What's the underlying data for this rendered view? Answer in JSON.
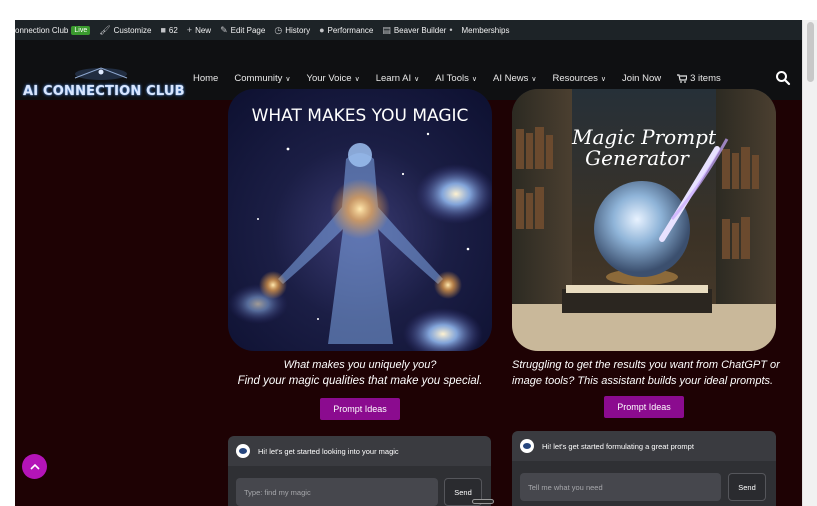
{
  "adminbar": {
    "site_name": "onnection Club",
    "live_badge": "Live",
    "customize": "Customize",
    "comments_count": "62",
    "new": "New",
    "edit_page": "Edit Page",
    "history": "History",
    "performance": "Performance",
    "beaver_builder": "Beaver Builder",
    "memberships": "Memberships"
  },
  "header": {
    "logo_text": "AI CONNECTION CLUB",
    "nav": [
      {
        "label": "Home",
        "has_caret": false
      },
      {
        "label": "Community",
        "has_caret": true
      },
      {
        "label": "Your Voice",
        "has_caret": true
      },
      {
        "label": "Learn AI",
        "has_caret": true
      },
      {
        "label": "AI Tools",
        "has_caret": true
      },
      {
        "label": "AI News",
        "has_caret": true
      },
      {
        "label": "Resources",
        "has_caret": true
      },
      {
        "label": "Join Now",
        "has_caret": false
      },
      {
        "label": "3 items",
        "has_caret": false
      }
    ],
    "search_icon": "search-icon"
  },
  "card1": {
    "image_title": "WHAT MAKES YOU MAGIC",
    "caption_line1": "What makes you uniquely you?",
    "caption_line2": "Find your magic qualities that make you special.",
    "button": "Prompt Ideas",
    "chat": {
      "greeting": "Hi! let's get started looking into your magic",
      "placeholder": "Type: find my magic",
      "send": "Send"
    }
  },
  "card2": {
    "image_title_line1": "Magic Prompt",
    "image_title_line2": "Generator",
    "caption_line1": "Struggling to get the results you want from ChatGPT or",
    "caption_line2": "image tools? This assistant builds your ideal prompts.",
    "button": "Prompt Ideas",
    "chat": {
      "greeting": "Hi! let's get started formulating a great prompt",
      "placeholder": "Tell me what you need",
      "send": "Send"
    }
  },
  "colors": {
    "page_bg": "#1e0204",
    "header_bg": "#0f1012",
    "button_bg": "#8b0b8f",
    "scroll_top_bg": "#b414b8",
    "chat_bg": "#3a3b40"
  }
}
